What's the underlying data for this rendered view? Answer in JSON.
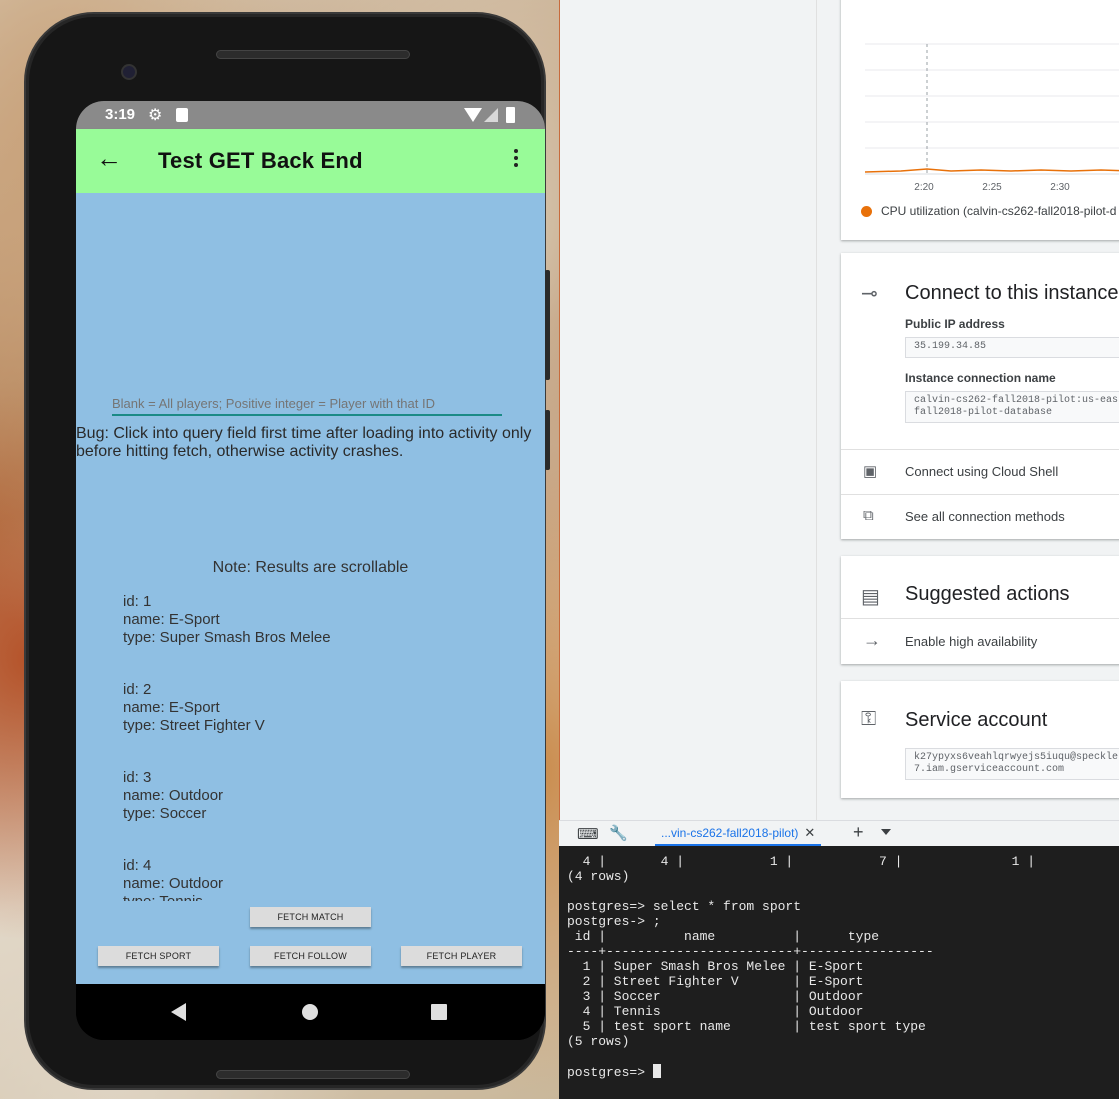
{
  "phone": {
    "status": {
      "time": "3:19"
    },
    "appbar": {
      "title": "Test GET Back End"
    },
    "query": {
      "placeholder": "Blank = All players; Positive integer = Player with that ID"
    },
    "bug_note": "Bug: Click into query field first time after loading into activity only before hitting fetch, otherwise activity crashes.",
    "results_note": "Note: Results are scrollable",
    "results": [
      {
        "id": "id: 1",
        "name": "name: E-Sport",
        "type": "type: Super Smash Bros Melee"
      },
      {
        "id": "id: 2",
        "name": "name: E-Sport",
        "type": "type: Street Fighter V"
      },
      {
        "id": "id: 3",
        "name": "name: Outdoor",
        "type": "type: Soccer"
      },
      {
        "id": "id: 4",
        "name": "name: Outdoor",
        "type": "type: Tennis"
      }
    ],
    "buttons": {
      "match": "FETCH MATCH",
      "sport": "FETCH SPORT",
      "follow": "FETCH FOLLOW",
      "player": "FETCH PLAYER"
    },
    "colors": {
      "appbar": "#98fb98",
      "content": "#8fbfe3",
      "input_underline": "#1b8a86"
    }
  },
  "console": {
    "chart": {
      "x_ticks": [
        "2:20",
        "2:25",
        "2:30"
      ],
      "legend": "CPU utilization (calvin-cs262-fall2018-pilot-d"
    },
    "connect": {
      "title": "Connect to this instance",
      "ip_label": "Public IP address",
      "ip_value": "35.199.34.85",
      "conn_label": "Instance connection name",
      "conn_value_1": "calvin-cs262-fall2018-pilot:us-eas",
      "conn_value_2": "fall2018-pilot-database",
      "cloud_shell": "Connect using Cloud Shell",
      "all_methods": "See all connection methods"
    },
    "actions": {
      "title": "Suggested actions",
      "item": "Enable high availability"
    },
    "service": {
      "title": "Service account",
      "value_1": "k27ypyxs6veahlqrwyejs5iuqu@speckle",
      "value_2": "7.iam.gserviceaccount.com"
    },
    "colors": {
      "accent": "#1a73e8",
      "cpu_series": "#e8710a"
    }
  },
  "shell": {
    "tab_label": "...vin-cs262-fall2018-pilot)",
    "terminal_lines": [
      "  4 |       4 |           1 |           7 |              1 |",
      "(4 rows)",
      "",
      "postgres=> select * from sport",
      "postgres-> ;",
      " id |          name          |      type",
      "----+------------------------+-----------------",
      "  1 | Super Smash Bros Melee | E-Sport",
      "  2 | Street Fighter V       | E-Sport",
      "  3 | Soccer                 | Outdoor",
      "  4 | Tennis                 | Outdoor",
      "  5 | test sport name        | test sport type",
      "(5 rows)",
      ""
    ],
    "prompt": "postgres=> "
  }
}
